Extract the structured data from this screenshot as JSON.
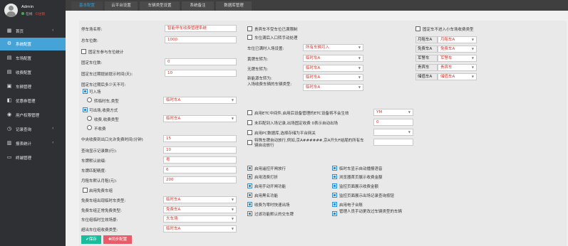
{
  "user": {
    "name": "Admin",
    "status": "在线",
    "logout": "注销"
  },
  "nav": [
    {
      "label": "首页",
      "icon": "▦",
      "chevron": "‹"
    },
    {
      "label": "系统配置",
      "icon": "⚙",
      "chevron": ""
    },
    {
      "label": "车场配置",
      "icon": "▤",
      "chevron": ""
    },
    {
      "label": "收费配置",
      "icon": "▤",
      "chevron": ""
    },
    {
      "label": "车辆管理",
      "icon": "▣",
      "chevron": ""
    },
    {
      "label": "优惠券管理",
      "icon": "◧",
      "chevron": ""
    },
    {
      "label": "用户权限管理",
      "icon": "◉",
      "chevron": ""
    },
    {
      "label": "记录查询",
      "icon": "◷",
      "chevron": "‹"
    },
    {
      "label": "报表统计",
      "icon": "▥",
      "chevron": "‹"
    },
    {
      "label": "终端管理",
      "icon": "▭",
      "chevron": ""
    }
  ],
  "tabs": [
    "基本配置",
    "云平台设置",
    "车辆类型设置",
    "系统备注",
    "数据库管理"
  ],
  "col1": {
    "name_label": "停车场名称:",
    "name_value": "智能停车收费管理系统",
    "spaces_label": "总车位数:",
    "spaces_value": "1000",
    "fixed_check": "固定车参与车位统计",
    "fixed_label": "固定车位数:",
    "fixed_value": "0",
    "expiry_label": "固定车过期提前提示时间(天):",
    "expiry_value": "10",
    "expired_label": "固定车过期后多少天不可:",
    "allow_in": "可入场",
    "convert_label": "转临时车,类型",
    "convert_value": "临时车A",
    "allow_out": "可出场,收费方式",
    "charge_type_label": "收费,收费类型",
    "charge_type_value": "临时车A",
    "no_charge": "不收费",
    "midway_label": "中央收费到出口允许免费时间(分钟)",
    "midway_value": "15",
    "query_label": "查询显示记录数(行):",
    "query_value": "10",
    "province_label": "车牌默认前缀:",
    "province_value": "粤",
    "match_label": "车牌匹配精度:",
    "match_value": "6",
    "monthly_label": "月租车默认月租(元):",
    "monthly_value": "200",
    "free_check": "启用免费车组",
    "free_temp_label": "免费车组出现临时车类型:",
    "free_temp_value": "临时车A",
    "free_fixed_label": "免费车组正常免费类型:",
    "free_fixed_value": "免费车A",
    "area_label": "车位组临时生效场景:",
    "area_value": "大车场",
    "super_label": "超出车位组收费类型:",
    "super_value": "临时车A",
    "save": "保存",
    "sync": "同步配置"
  },
  "col2": {
    "c1": "贵宾车不受车位已满限制",
    "c2": "车位满后入口转手动处理",
    "full_label": "车位已满时入场设置:",
    "full_value": "所有车辆可入",
    "l1": "黄牌车转为:",
    "v1": "临时车A",
    "l2": "无牌车转为:",
    "v2": "临时车A",
    "l3": "新能源车转为:",
    "v3": "临时车A",
    "l4": "入场收费车辆的车辆类型:",
    "v4": "临时车A",
    "etc_label": "启用ETC中间件,启用后设备管理的ETC设备将不会生效",
    "etc_value": "YM",
    "unpaid_label": "未匹配到入场记录,出场固定收费 0表示自动出场",
    "unpaid_value": "0",
    "pc_label": "启用PC数据库,选择存储为平台网关",
    "special_label": "特殊车牌自动放行,例如,京A######,京A开头F结尾的所有车辆自动放行",
    "g1": "启用遥控开闸放行",
    "g2": "启用消费打折",
    "g3": "启用手动开闸功能",
    "g4": "启用黑名功能",
    "g5": "收费为零时快速出场",
    "g6": "过滤功能默认的交车牌"
  },
  "col3": {
    "g1": "临时车显示自动播报语音",
    "g2": "浏览器首页展示收费金额",
    "g3": "监控页面展示收费金额",
    "g4": "监控页面展示出场记录查询按钮",
    "g5": "启用电子台账",
    "g6": "管理人员手动更改过车辆类型的车辆"
  },
  "col4": {
    "check": "固定车不进入小车场收费类型",
    "rows": [
      {
        "label": "月租车A",
        "value": "月租车A"
      },
      {
        "label": "免费车A",
        "value": "免费车A"
      },
      {
        "label": "军警车",
        "value": "军警车"
      },
      {
        "label": "贵宾车",
        "value": "贵宾车"
      },
      {
        "label": "储值车A",
        "value": "储值车A"
      }
    ]
  },
  "colors": {
    "sidebar": "#2f3033",
    "accent": "#45a3d8",
    "save": "#1abc9c",
    "sync": "#e85c6a"
  }
}
